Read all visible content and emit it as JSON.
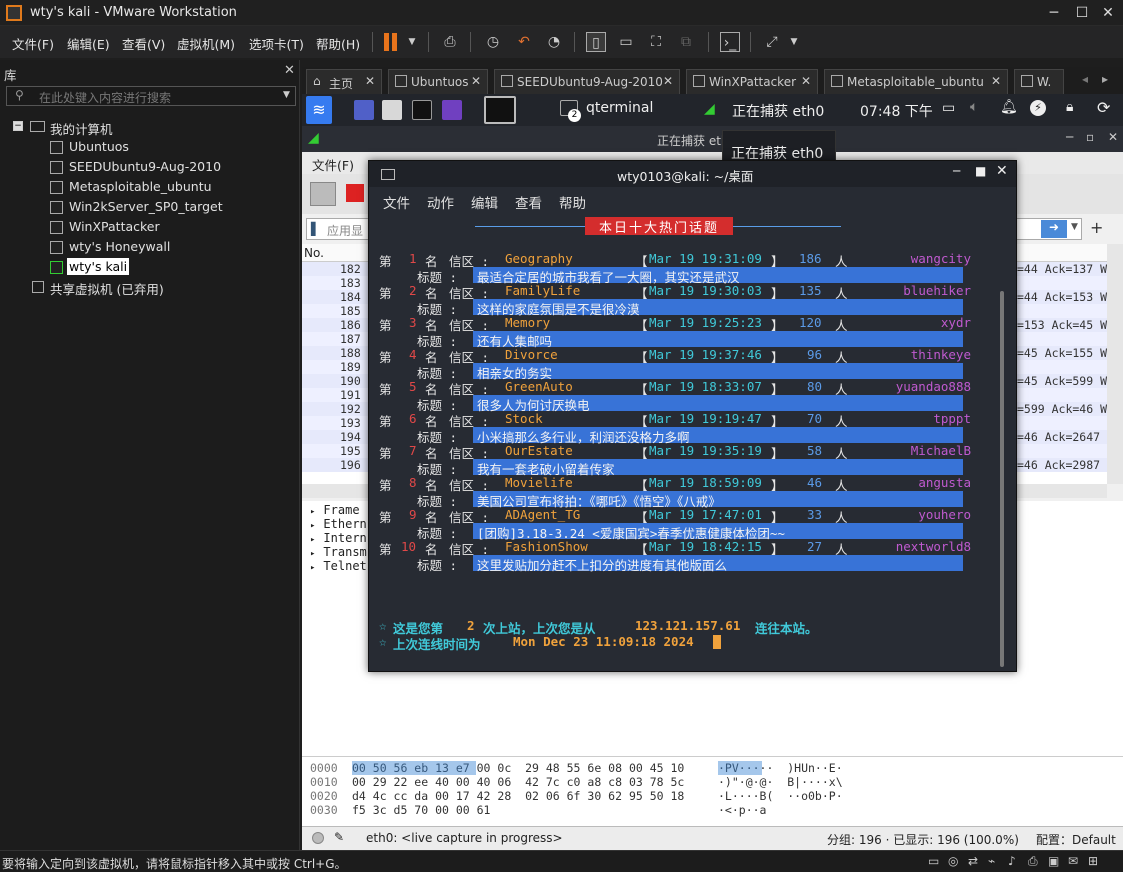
{
  "window": {
    "title": "wty's kali - VMware Workstation"
  },
  "menubar": {
    "items": [
      "文件(F)",
      "编辑(E)",
      "查看(V)",
      "虚拟机(M)",
      "选项卡(T)",
      "帮助(H)"
    ]
  },
  "library": {
    "title": "库",
    "search_placeholder": "在此处键入内容进行搜索",
    "root": "我的计算机",
    "vms": [
      "Ubuntuos",
      "SEEDUbuntu9-Aug-2010",
      "Metasploitable_ubuntu",
      "Win2kServer_SP0_target",
      "WinXPattacker",
      "wty's Honeywall",
      "wty's kali"
    ],
    "shared": "共享虚拟机 (已弃用)"
  },
  "tabs": [
    "主页",
    "Ubuntuos",
    "SEEDUbuntu9-Aug-2010",
    "WinXPattacker",
    "Metasploitable_ubuntu",
    "W."
  ],
  "kali_panel": {
    "app": "qterminal",
    "badge": "2",
    "capture": "正在捕获 eth0",
    "clock": "07:48 下午"
  },
  "tooltip": "正在捕获 eth0",
  "wireshark": {
    "title": "正在捕获 eth0",
    "menu_visible": "文件(F)",
    "filter_placeholder": "应用显",
    "list_header": "No.",
    "rows": [
      {
        "no": "182",
        "info": "=44 Ack=137 W"
      },
      {
        "no": "183",
        "info": ""
      },
      {
        "no": "184",
        "info": "=44 Ack=153 W"
      },
      {
        "no": "185",
        "info": ""
      },
      {
        "no": "186",
        "info": "=153 Ack=45 W"
      },
      {
        "no": "187",
        "info": ""
      },
      {
        "no": "188",
        "info": "=45 Ack=155 W"
      },
      {
        "no": "189",
        "info": ""
      },
      {
        "no": "190",
        "info": "=45 Ack=599 W"
      },
      {
        "no": "191",
        "info": ""
      },
      {
        "no": "192",
        "info": "=599 Ack=46 W"
      },
      {
        "no": "193",
        "info": ""
      },
      {
        "no": "194",
        "info": "=46 Ack=2647"
      },
      {
        "no": "195",
        "info": ""
      },
      {
        "no": "196",
        "info": "=46 Ack=2987"
      }
    ],
    "detail": [
      "Frame",
      "Ethern",
      "Intern",
      "Transm",
      "Telnet"
    ],
    "hex": [
      {
        "off": "0000",
        "hex": "00 50 56 eb 13 e7 00 0c  29 48 55 6e 08 00 45 10",
        "ascii": "·PV·····  )HUn··E·"
      },
      {
        "off": "0010",
        "hex": "00 29 22 ee 40 00 40 06  42 7c c0 a8 c8 03 78 5c",
        "ascii": "·)\"·@·@·  B|····x\\"
      },
      {
        "off": "0020",
        "hex": "d4 4c cc da 00 17 42 28  02 06 6f 30 62 95 50 18",
        "ascii": "·L····B(  ··o0b·P·"
      },
      {
        "off": "0030",
        "hex": "f5 3c d5 70 00 00 61",
        "ascii": "·<·p··a"
      }
    ],
    "status_left": "eth0: <live capture in progress>",
    "status_mid": "分组: 196 · 已显示: 196 (100.0%)",
    "status_right": "配置：Default"
  },
  "terminal": {
    "title": "wty0103@kali: ~/桌面",
    "menu": [
      "文件",
      "动作",
      "编辑",
      "查看",
      "帮助"
    ],
    "banner": "本日十大热门话题",
    "topics": [
      {
        "rank": "1",
        "board": "Geography",
        "time": "Mar 19 19:31:09",
        "count": "186",
        "user": "wangcity",
        "title": "最适合定居的城市我看了一大圈，其实还是武汉"
      },
      {
        "rank": "2",
        "board": "FamilyLife",
        "time": "Mar 19 19:30:03",
        "count": "135",
        "user": "bluehiker",
        "title": "这样的家庭氛围是不是很冷漠"
      },
      {
        "rank": "3",
        "board": "Memory",
        "time": "Mar 19 19:25:23",
        "count": "120",
        "user": "xydr",
        "title": "还有人集邮吗"
      },
      {
        "rank": "4",
        "board": "Divorce",
        "time": "Mar 19 19:37:46",
        "count": "96",
        "user": "thinkeye",
        "title": "相亲女的务实"
      },
      {
        "rank": "5",
        "board": "GreenAuto",
        "time": "Mar 19 18:33:07",
        "count": "80",
        "user": "yuandao888",
        "title": "很多人为何讨厌换电"
      },
      {
        "rank": "6",
        "board": "Stock",
        "time": "Mar 19 19:19:47",
        "count": "70",
        "user": "tpppt",
        "title": "小米搞那么多行业，利润还没格力多啊"
      },
      {
        "rank": "7",
        "board": "OurEstate",
        "time": "Mar 19 19:35:19",
        "count": "58",
        "user": "MichaelB",
        "title": "我有一套老破小留着传家"
      },
      {
        "rank": "8",
        "board": "Movielife",
        "time": "Mar 19 18:59:09",
        "count": "46",
        "user": "angusta",
        "title": "美国公司宣布将拍：《哪吒》《悟空》《八戒》"
      },
      {
        "rank": "9",
        "board": "ADAgent_TG",
        "time": "Mar 19 17:47:01",
        "count": "33",
        "user": "youhero",
        "title": "[团购]3.18-3.24 <爱康国宾>春季优惠健康体检团~~"
      },
      {
        "rank": "10",
        "board": "FashionShow",
        "time": "Mar 19 18:42:15",
        "count": "27",
        "user": "nextworld8",
        "title": "这里发贴加分赶不上扣分的进度有其他版面么"
      }
    ],
    "labels": {
      "di": "第",
      "ming": "名",
      "xinqu": "信区 :",
      "ren": "人",
      "biaoti": "标题 :"
    },
    "footer1": {
      "star": "☆",
      "a": "这是您第",
      "n": "2",
      "b": "次上站，上次您是从",
      "ip": "123.121.157.61",
      "c": "连往本站。"
    },
    "footer2": {
      "star": "☆",
      "a": "上次连线时间为",
      "t": "Mon Dec 23 11:09:18 2024"
    }
  },
  "statusbar": {
    "message": "要将输入定向到该虚拟机，请将鼠标指针移入其中或按 Ctrl+G。"
  }
}
